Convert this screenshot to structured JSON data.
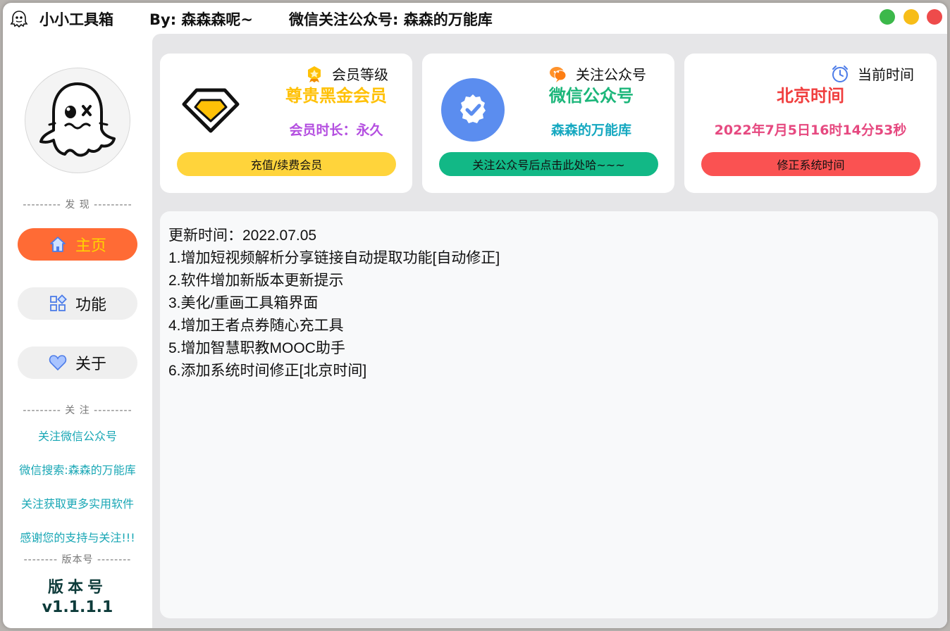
{
  "titlebar": {
    "app_name": "小小工具箱",
    "author": "By: 森森森呢~",
    "wechat": "微信关注公众号: 森森的万能库"
  },
  "sidebar": {
    "section_discover": "--------- 发 现 ---------",
    "nav": [
      {
        "label": "主页",
        "icon": "home-icon",
        "active": true
      },
      {
        "label": "功能",
        "icon": "grid-icon",
        "active": false
      },
      {
        "label": "关于",
        "icon": "heart-icon",
        "active": false
      }
    ],
    "section_follow": "--------- 关 注 ---------",
    "follow_lines": [
      "关注微信公众号",
      "微信搜索:森森的万能库",
      "关注获取更多实用软件",
      "感谢您的支持与关注!!!"
    ],
    "section_version": "-------- 版本号 --------",
    "version_title": "版本号",
    "version_number": "v1.1.1.1"
  },
  "cards": {
    "member": {
      "header": "会员等级",
      "title": "尊贵黑金会员",
      "subtitle": "会员时长：永久",
      "button": "充值/续费会员",
      "title_color": "#ffc107",
      "subtitle_color": "#b44fe0",
      "button_color": "#ffd43b"
    },
    "follow": {
      "header": "关注公众号",
      "title": "微信公众号",
      "subtitle": "森森的万能库",
      "button": "关注公众号后点击此处哈~~~",
      "title_color": "#1cb67a",
      "subtitle_color": "#15a8c0",
      "button_color": "#12b886"
    },
    "time": {
      "header": "当前时间",
      "title": "北京时间",
      "subtitle": "2022年7月5日16时14分53秒",
      "button": "修正系统时间",
      "title_color": "#f03e3e",
      "subtitle_color": "#e64980",
      "button_color": "#fa5252"
    }
  },
  "changelog": [
    "更新时间：2022.07.05",
    "1.增加短视频解析分享链接自动提取功能[自动修正]",
    "2.软件增加新版本更新提示",
    "3.美化/重画工具箱界面",
    "4.增加王者点券随心充工具",
    "5.增加智慧职教MOOC助手",
    "6.添加系统时间修正[北京时间]"
  ],
  "colors": {
    "accent": "#ff6b35",
    "nav_active_text": "#ffd400",
    "follow_text": "#19a7b5"
  }
}
